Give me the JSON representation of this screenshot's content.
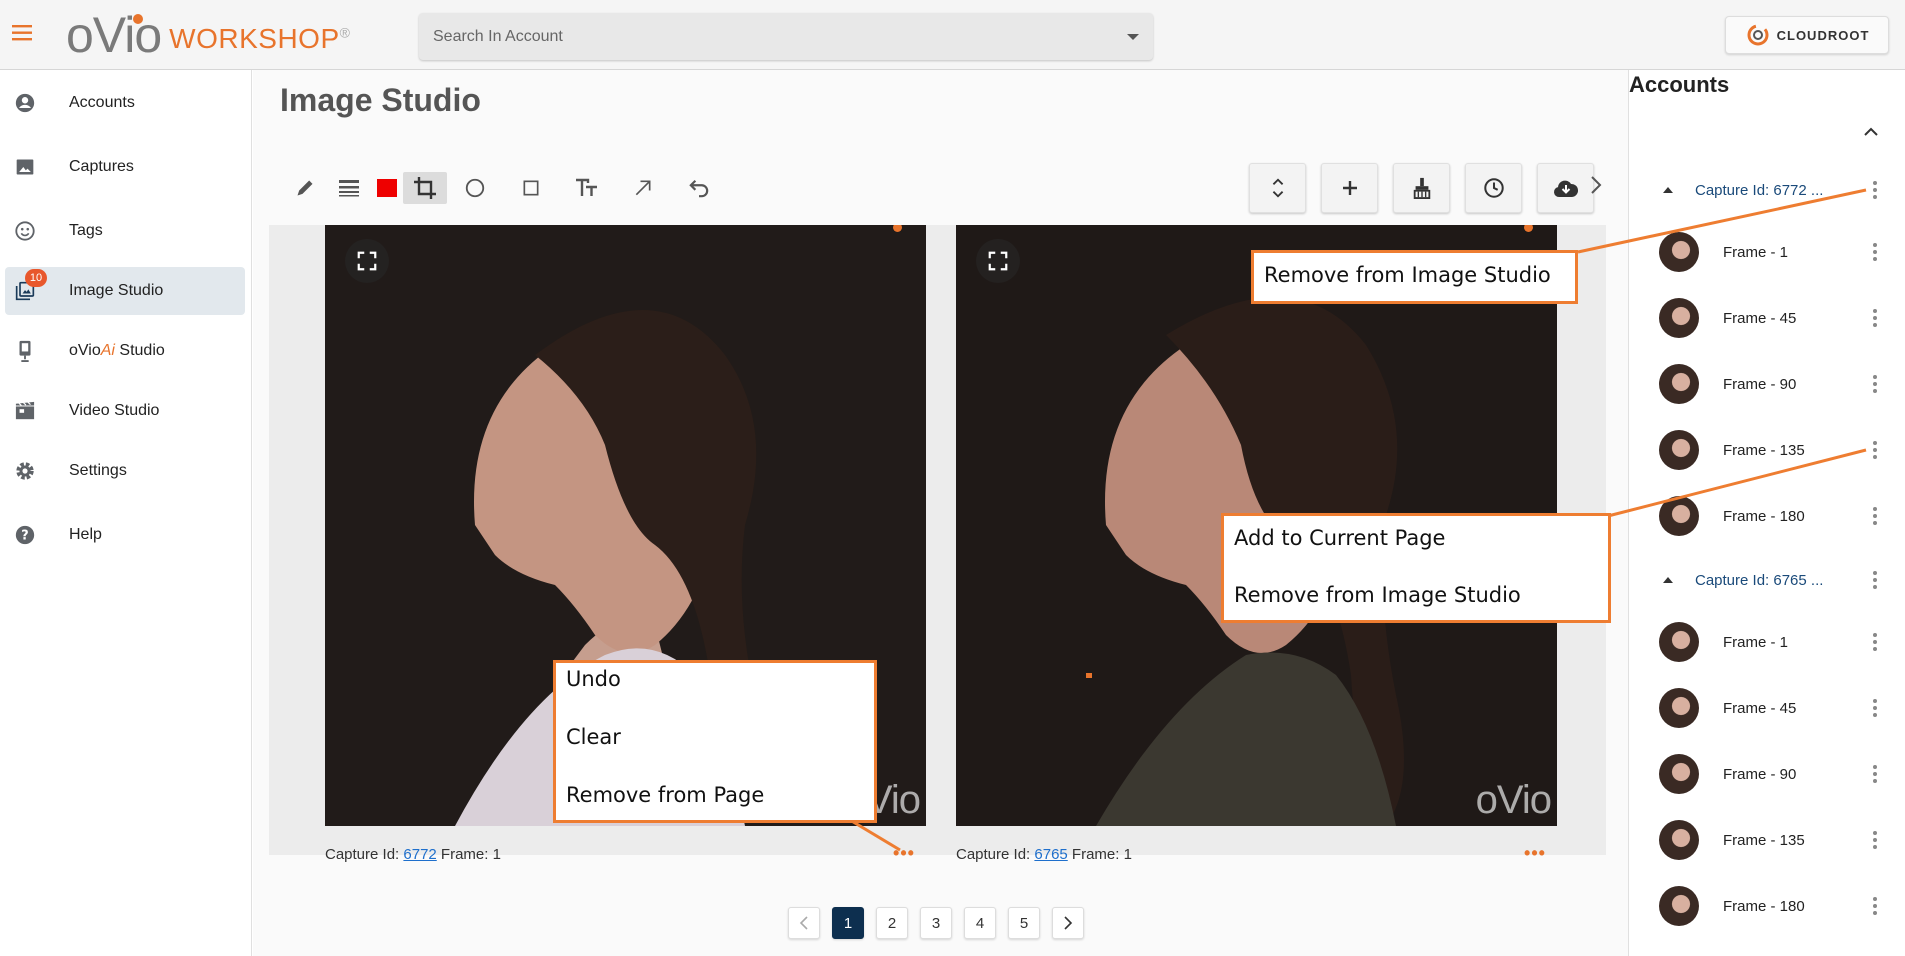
{
  "header": {
    "logo_text": "oVio",
    "logo_sub": "WORKSHOP",
    "logo_reg": "®",
    "search_placeholder": "Search In Account",
    "cloud_label": "CLOUDROOT"
  },
  "sidebar": {
    "items": [
      {
        "label": "Accounts",
        "icon": "account-circle-icon"
      },
      {
        "label": "Captures",
        "icon": "image-icon"
      },
      {
        "label": "Tags",
        "icon": "smiley-icon"
      },
      {
        "label": "Image Studio",
        "icon": "photo-library-icon",
        "badge": "10",
        "active": true
      },
      {
        "label_prefix": "oVio",
        "label_ai": "Ai",
        "label_suffix": " Studio",
        "icon": "phone-studio-icon"
      },
      {
        "label": "Video Studio",
        "icon": "video-icon"
      },
      {
        "label": "Settings",
        "icon": "gear-icon"
      },
      {
        "label": "Help",
        "icon": "help-icon"
      }
    ]
  },
  "main": {
    "title": "Image Studio",
    "photos": [
      {
        "capture_prefix": "Capture Id: ",
        "capture_id": "6772",
        "frame_text": " Frame: 1"
      },
      {
        "capture_prefix": "Capture Id: ",
        "capture_id": "6765",
        "frame_text": " Frame: 1"
      }
    ],
    "watermark": "oVio",
    "pager": [
      "1",
      "2",
      "3",
      "4",
      "5"
    ],
    "current_page": "1"
  },
  "right_panel": {
    "title": "Accounts",
    "captures": [
      {
        "label": "Capture Id: 6772 ...",
        "frames": [
          "Frame - 1",
          "Frame - 45",
          "Frame - 90",
          "Frame - 135",
          "Frame - 180"
        ]
      },
      {
        "label": "Capture Id: 6765 ...",
        "frames": [
          "Frame - 1",
          "Frame - 45",
          "Frame - 90",
          "Frame - 135",
          "Frame - 180"
        ]
      }
    ]
  },
  "callouts": {
    "photo_menu": [
      "Undo",
      "Clear",
      "Remove from Page"
    ],
    "capture_menu": [
      "Remove from Image Studio"
    ],
    "frame_menu": [
      "Add to Current Page",
      "Remove from Image Studio"
    ]
  },
  "colors": {
    "accent": "#e8742c",
    "callout_border": "#ee7d31",
    "active_nav": "#e2e8ed",
    "current_page": "#0d2f4f",
    "link": "#1e6fcc"
  }
}
